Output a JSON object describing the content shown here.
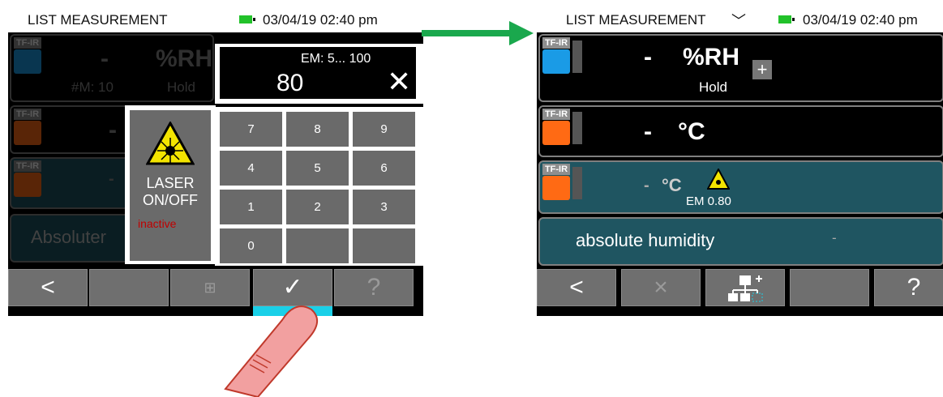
{
  "left_screen": {
    "status_title": "LIST MEASUREMENT",
    "datetime": "03/04/19 02:40 pm",
    "row1": {
      "sensor": "TF-IR BL",
      "value": "-",
      "unit": "%RH",
      "count": "#M: 10",
      "mode": "Hold"
    },
    "row2": {
      "sensor": "TF-IR BL",
      "value": "-"
    },
    "row3": {
      "sensor": "TF-IR BL",
      "value": "-"
    },
    "row4": {
      "label": "Absoluter"
    },
    "em_input": {
      "range": "EM: 5... 100",
      "value": "80",
      "clear_icon": "close-icon"
    },
    "laser_panel": {
      "label": "LASER ON/OFF",
      "state": "inactive"
    },
    "keypad_keys": [
      "7",
      "8",
      "9",
      "4",
      "5",
      "6",
      "1",
      "2",
      "3",
      "0",
      "",
      ""
    ],
    "toolbar": {
      "back": "<",
      "confirm_icon": "check-icon",
      "help": "?"
    }
  },
  "right_screen": {
    "status_title": "LIST MEASUREMENT",
    "datetime": "03/04/19 02:40 pm",
    "row1": {
      "sensor": "TF-IR BL",
      "value": "-",
      "unit": "%RH",
      "mode": "Hold",
      "add": "+"
    },
    "row2": {
      "sensor": "TF-IR BL",
      "value": "-",
      "unit": "°C"
    },
    "row3": {
      "sensor": "TF-IR BL",
      "value": "-",
      "unit": "°C",
      "em": "EM 0.80"
    },
    "row4": {
      "label": "absolute humidity",
      "value": "-"
    },
    "toolbar": {
      "back": "<",
      "close": "×",
      "help": "?"
    }
  },
  "colors": {
    "accent": "#1a9be6",
    "hot": "#ff6a14",
    "teal": "#1f5561",
    "arrow": "#1aa84d",
    "finger": "#f2a0a0"
  }
}
